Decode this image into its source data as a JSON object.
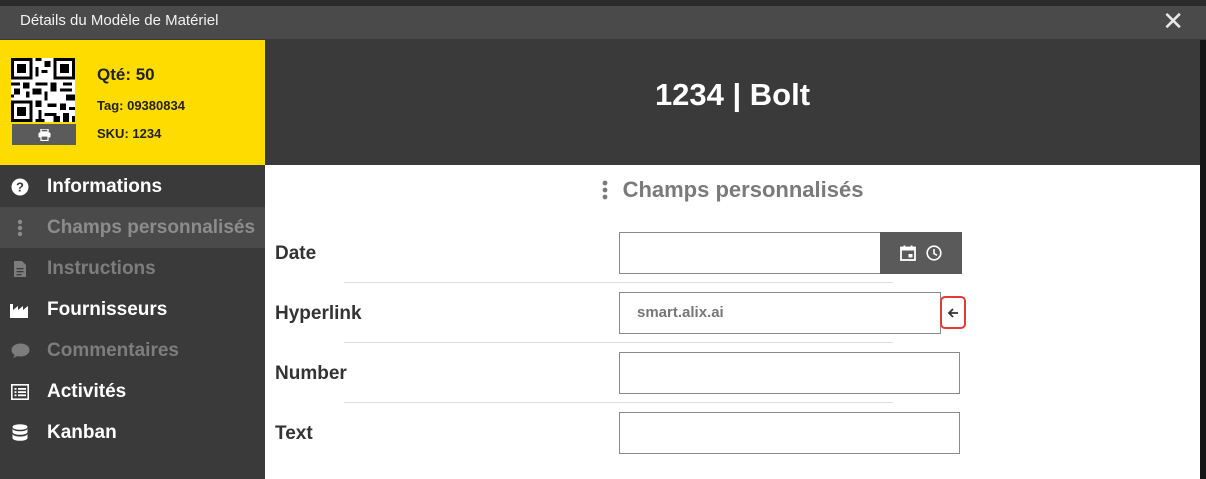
{
  "window": {
    "title": "Détails du Modèle de Matériel",
    "close_symbol": "✕"
  },
  "summary": {
    "qty": "Qté: 50",
    "tag": "Tag: 09380834",
    "sku": "SKU: 1234",
    "accent_color": "#ffdc00"
  },
  "sidebar": {
    "items": [
      {
        "label": "Informations",
        "icon": "question-circle-icon",
        "state": "normal"
      },
      {
        "label": "Champs personnalisés",
        "icon": "vertical-dots-icon",
        "state": "active"
      },
      {
        "label": "Instructions",
        "icon": "document-icon",
        "state": "disabled"
      },
      {
        "label": "Fournisseurs",
        "icon": "factory-icon",
        "state": "normal"
      },
      {
        "label": "Commentaires",
        "icon": "speech-bubble-icon",
        "state": "disabled"
      },
      {
        "label": "Activités",
        "icon": "list-icon",
        "state": "normal"
      },
      {
        "label": "Kanban",
        "icon": "database-icon",
        "state": "normal"
      }
    ]
  },
  "header": {
    "title": "1234 | Bolt"
  },
  "content": {
    "section_title": "Champs personnalisés",
    "fields": [
      {
        "label": "Date",
        "value": ""
      },
      {
        "label": "Hyperlink",
        "value": "smart.alix.ai"
      },
      {
        "label": "Number",
        "value": ""
      },
      {
        "label": "Text",
        "value": ""
      }
    ]
  }
}
